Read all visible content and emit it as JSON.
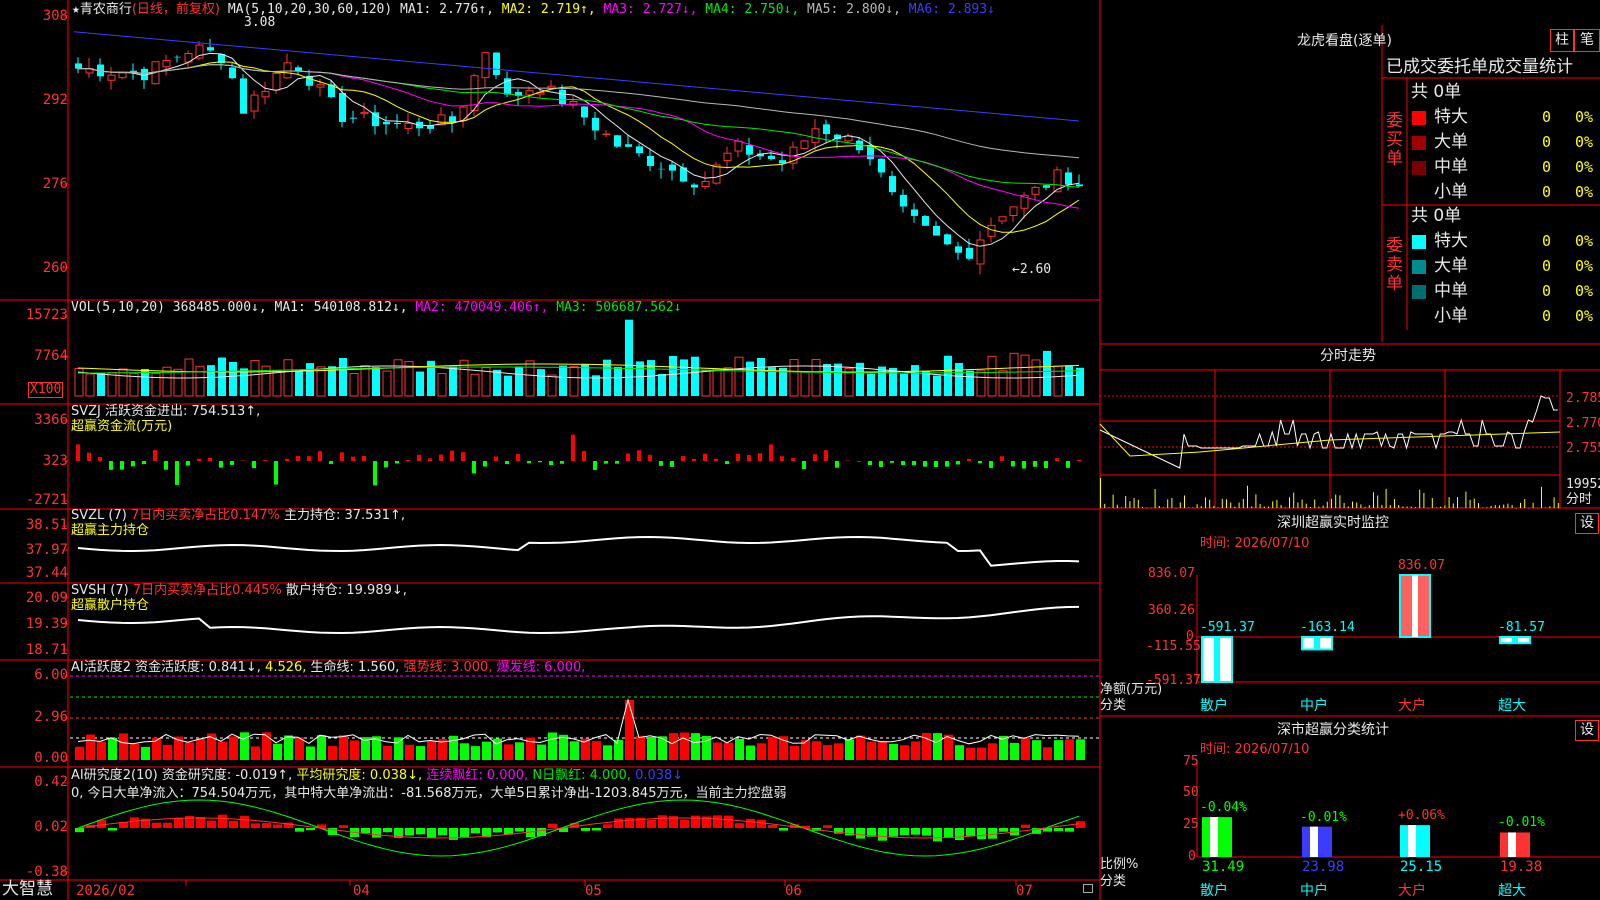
{
  "colors": {
    "up": "#ff3232",
    "down": "#00ffff",
    "ma1": "#e8e8e8",
    "ma2": "#ffff00",
    "ma3": "#ff00ff",
    "ma4": "#00e800",
    "ma5": "#b8b8b8",
    "ma6": "#3c3cff",
    "grid": "#ff0000"
  },
  "header": {
    "star": "★",
    "stock_name": "青农商行",
    "period": "(日线，前复权)",
    "ma_label": "MA(5,10,20,30,60,120)",
    "ma1": "MA1: 2.776↑,",
    "ma2": "MA2: 2.719↑,",
    "ma3": "MA3: 2.727↓,",
    "ma4": "MA4: 2.750↓,",
    "ma5": "MA5: 2.800↓,",
    "ma6": "MA6: 2.893↓"
  },
  "price_panel": {
    "y_labels": [
      "308",
      "292",
      "276",
      "260"
    ],
    "high_marker": "3.08",
    "low_marker": "←2.60"
  },
  "vol_panel": {
    "title": "VOL(5,10,20)",
    "vol": "368485.000↓,",
    "ma1": "MA1: 540108.812↓,",
    "ma2": "MA2: 470049.406↑,",
    "ma3": "MA3: 506687.562↓",
    "y_labels": [
      "15723",
      "7764"
    ],
    "unit": "X100"
  },
  "svzj_panel": {
    "line1": "SVZJ  活跃资金进出: 754.513↑,",
    "line2": "超赢资金流(万元)",
    "y_labels": [
      "3366",
      "323",
      "-2721"
    ]
  },
  "svzl_panel": {
    "title": "SVZL (7)",
    "desc": "7日内买卖净占比0.147%",
    "value": "主力持仓: 37.531↑,",
    "line2": "超赢主力持仓",
    "y_labels": [
      "38.51",
      "37.97",
      "37.44"
    ]
  },
  "svsh_panel": {
    "title": "SVSH (7)",
    "desc": "7日内买卖净占比0.445%",
    "value": "散户持仓: 19.989↓,",
    "line2": "超赢散户持仓",
    "y_labels": [
      "20.09",
      "19.39",
      "18.71"
    ]
  },
  "ai_active_panel": {
    "title": "AI活跃度2",
    "v1": "资金活跃度: 0.841↓,",
    "v2": "4.526,",
    "v3": "生命线: 1.560,",
    "v4": "强势线: 3.000,",
    "v5": "爆发线: 6.000,",
    "y_labels": [
      "6.00",
      "2.96",
      "0.00"
    ]
  },
  "ai_research_panel": {
    "title": "AI研究度2(10)",
    "v1": "资金研究度: -0.019↑,",
    "v2": "平均研究度: 0.038↓,",
    "v3": "连续飘红: 0.000,",
    "v4": "N日飘红: 4.000,",
    "v5": "0.038↓",
    "summary": "0, 今日大单净流入：754.504万元，其中特大单净流出：-81.568万元，大单5日累计净出-1203.845万元，当前主力控盘弱",
    "y_labels": [
      "0.42",
      "0.02",
      "-0.38"
    ]
  },
  "bottom_bar": {
    "brand": "大智慧",
    "dates": [
      "2026/02",
      "04",
      "05",
      "06",
      "07"
    ]
  },
  "right_panel": {
    "btn_column": "柱",
    "btn_stroke": "笔",
    "dragon_title": "龙虎看盘(逐单)",
    "table_title": "已成交委托单成交量统计",
    "buy_group": {
      "label": "委买单",
      "total": "共 0单",
      "rows": [
        {
          "name": "特大",
          "qty": "0",
          "pct": "0%",
          "color": "#ff0000"
        },
        {
          "name": "大单",
          "qty": "0",
          "pct": "0%",
          "color": "#a00000"
        },
        {
          "name": "中单",
          "qty": "0",
          "pct": "0%",
          "color": "#780000"
        },
        {
          "name": "小单",
          "qty": "0",
          "pct": "0%",
          "color": "#000000"
        }
      ]
    },
    "sell_group": {
      "label": "委卖单",
      "total": "共 0单",
      "rows": [
        {
          "name": "特大",
          "qty": "0",
          "pct": "0%",
          "color": "#00ffff"
        },
        {
          "name": "大单",
          "qty": "0",
          "pct": "0%",
          "color": "#008c8c"
        },
        {
          "name": "中单",
          "qty": "0",
          "pct": "0%",
          "color": "#006e6e"
        },
        {
          "name": "小单",
          "qty": "0",
          "pct": "0%",
          "color": "#000000"
        }
      ]
    },
    "intraday_title": "分时走势",
    "intraday_labels": [
      "2.785",
      "2.770",
      "2.755"
    ],
    "intraday_vol": "19952",
    "intraday_unit": "分时",
    "monitor_title": "深圳超赢实时监控",
    "monitor_btn": "设",
    "monitor_time": "时间: 2026/07/10",
    "monitor_axis": [
      "836.07",
      "360.26",
      "0",
      "-115.55",
      "-591.37"
    ],
    "monitor_side": [
      "净额(万元)",
      "分类"
    ],
    "monitor_chart": {
      "categories": [
        "散户",
        "中户",
        "大户",
        "超大"
      ],
      "values": [
        -591.37,
        -163.14,
        836.07,
        -81.57
      ],
      "labels": [
        "-591.37",
        "-163.14",
        "836.07",
        "-81.57"
      ]
    },
    "stats_title": "深市超赢分类统计",
    "stats_btn": "设",
    "stats_time": "时间: 2026/07/10",
    "stats_axis": [
      "75",
      "50",
      "25",
      "0"
    ],
    "stats_side": [
      "比例%",
      "分类"
    ],
    "stats_chart": {
      "categories": [
        "散户",
        "中户",
        "大户",
        "超大"
      ],
      "values": [
        31.49,
        23.98,
        25.15,
        19.38
      ],
      "values_text": [
        "31.49",
        "23.98",
        "25.15",
        "19.38"
      ],
      "changes": [
        "-0.04%",
        "-0.01%",
        "+0.06%",
        "-0.01%"
      ],
      "colors": [
        "#00ff00",
        "#3c3cff",
        "#00ffff",
        "#ff3232"
      ]
    }
  }
}
